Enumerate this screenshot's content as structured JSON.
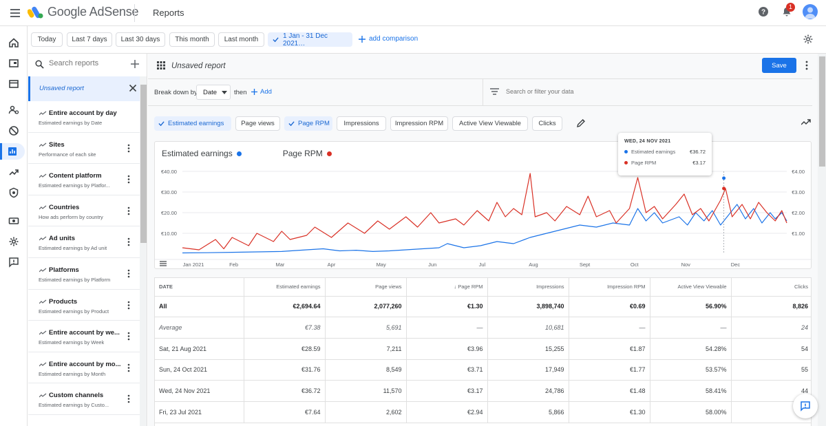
{
  "app": {
    "logo_text": "Google AdSense",
    "page_title": "Reports",
    "notification_count": "1"
  },
  "date_range": {
    "chips": [
      "Today",
      "Last 7 days",
      "Last 30 days",
      "This month",
      "Last month"
    ],
    "selected": "1 Jan - 31 Dec 2021…",
    "add_comparison": "add comparison"
  },
  "reports_panel": {
    "search_placeholder": "Search reports",
    "unsaved_label": "Unsaved report",
    "items": [
      {
        "title": "Entire account by day",
        "subtitle": "Estimated earnings by Date"
      },
      {
        "title": "Sites",
        "subtitle": "Performance of each site"
      },
      {
        "title": "Content platform",
        "subtitle": "Estimated earnings by Platfor..."
      },
      {
        "title": "Countries",
        "subtitle": "How ads perform by country"
      },
      {
        "title": "Ad units",
        "subtitle": "Estimated earnings by Ad unit"
      },
      {
        "title": "Platforms",
        "subtitle": "Estimated earnings by Platform"
      },
      {
        "title": "Products",
        "subtitle": "Estimated earnings by Product"
      },
      {
        "title": "Entire account by we...",
        "subtitle": "Estimated earnings by Week"
      },
      {
        "title": "Entire account by mo...",
        "subtitle": "Estimated earnings by Month"
      },
      {
        "title": "Custom channels",
        "subtitle": "Estimated earnings by Custo..."
      }
    ]
  },
  "main": {
    "report_name": "Unsaved report",
    "save_label": "Save",
    "breakdown_label": "Break down by",
    "breakdown_value": "Date",
    "then_label": "then",
    "add_label": "Add",
    "filter_placeholder": "Search or filter your data",
    "metrics": [
      {
        "label": "Estimated earnings",
        "selected": true
      },
      {
        "label": "Page views",
        "selected": false
      },
      {
        "label": "Page RPM",
        "selected": true
      },
      {
        "label": "Impressions",
        "selected": false
      },
      {
        "label": "Impression RPM",
        "selected": false
      },
      {
        "label": "Active View Viewable",
        "selected": false
      },
      {
        "label": "Clicks",
        "selected": false
      }
    ]
  },
  "chart_data": {
    "type": "line",
    "legend": [
      {
        "name": "Estimated earnings",
        "color": "#1a73e8"
      },
      {
        "name": "Page RPM",
        "color": "#d93025"
      }
    ],
    "x_ticks": [
      "Jan 2021",
      "Feb",
      "Mar",
      "Apr",
      "May",
      "Jun",
      "Jul",
      "Aug",
      "Sept",
      "Oct",
      "Nov",
      "Dec"
    ],
    "y_left_ticks": [
      "€10.00",
      "€20.00",
      "€30.00",
      "€40.00"
    ],
    "y_right_ticks": [
      "€1.00",
      "€2.00",
      "€3.00",
      "€4.00"
    ],
    "y_left_range": [
      0,
      40
    ],
    "y_right_range": [
      0,
      4
    ],
    "x_range_days": [
      0,
      365
    ],
    "series": [
      {
        "name": "Estimated earnings",
        "axis": "left",
        "color": "#1a73e8",
        "points": [
          [
            0,
            0.5
          ],
          [
            15,
            0.6
          ],
          [
            30,
            0.8
          ],
          [
            45,
            1
          ],
          [
            60,
            1.2
          ],
          [
            75,
            2
          ],
          [
            85,
            2.5
          ],
          [
            95,
            1.5
          ],
          [
            105,
            1.8
          ],
          [
            115,
            1.2
          ],
          [
            125,
            1.5
          ],
          [
            135,
            2
          ],
          [
            145,
            2.5
          ],
          [
            155,
            3
          ],
          [
            160,
            5
          ],
          [
            170,
            3
          ],
          [
            180,
            4
          ],
          [
            190,
            6
          ],
          [
            200,
            5
          ],
          [
            210,
            8
          ],
          [
            220,
            10
          ],
          [
            230,
            12
          ],
          [
            240,
            14
          ],
          [
            250,
            13
          ],
          [
            260,
            15
          ],
          [
            270,
            14
          ],
          [
            275,
            22
          ],
          [
            280,
            16
          ],
          [
            285,
            20
          ],
          [
            290,
            15
          ],
          [
            300,
            18
          ],
          [
            305,
            14
          ],
          [
            310,
            20
          ],
          [
            315,
            16
          ],
          [
            320,
            21
          ],
          [
            325,
            14
          ],
          [
            330,
            19
          ],
          [
            335,
            24
          ],
          [
            340,
            17
          ],
          [
            345,
            22
          ],
          [
            350,
            15
          ],
          [
            355,
            20
          ],
          [
            358,
            17
          ],
          [
            362,
            20
          ],
          [
            365,
            16
          ]
        ]
      },
      {
        "name": "Page RPM",
        "axis": "right",
        "color": "#d93025",
        "points": [
          [
            0,
            0.3
          ],
          [
            10,
            0.2
          ],
          [
            20,
            0.7
          ],
          [
            25,
            0.25
          ],
          [
            30,
            0.8
          ],
          [
            40,
            0.4
          ],
          [
            45,
            1.0
          ],
          [
            55,
            0.6
          ],
          [
            60,
            1.1
          ],
          [
            65,
            0.7
          ],
          [
            75,
            0.9
          ],
          [
            80,
            1.3
          ],
          [
            90,
            0.8
          ],
          [
            100,
            1.5
          ],
          [
            110,
            1.0
          ],
          [
            118,
            1.6
          ],
          [
            125,
            1.2
          ],
          [
            135,
            1.8
          ],
          [
            142,
            1.3
          ],
          [
            150,
            2.0
          ],
          [
            155,
            1.5
          ],
          [
            165,
            1.7
          ],
          [
            170,
            1.4
          ],
          [
            178,
            2.1
          ],
          [
            185,
            1.6
          ],
          [
            190,
            2.5
          ],
          [
            195,
            1.8
          ],
          [
            200,
            2.2
          ],
          [
            205,
            1.9
          ],
          [
            210,
            3.9
          ],
          [
            213,
            1.8
          ],
          [
            220,
            2.0
          ],
          [
            225,
            1.6
          ],
          [
            232,
            2.3
          ],
          [
            240,
            1.9
          ],
          [
            245,
            2.8
          ],
          [
            250,
            1.8
          ],
          [
            258,
            2.1
          ],
          [
            262,
            1.5
          ],
          [
            270,
            2.2
          ],
          [
            275,
            3.7
          ],
          [
            280,
            2.0
          ],
          [
            285,
            2.3
          ],
          [
            290,
            1.7
          ],
          [
            298,
            2.4
          ],
          [
            303,
            2.9
          ],
          [
            308,
            1.9
          ],
          [
            313,
            2.2
          ],
          [
            318,
            1.6
          ],
          [
            325,
            2.6
          ],
          [
            328,
            3.17
          ],
          [
            332,
            1.8
          ],
          [
            338,
            2.4
          ],
          [
            343,
            1.7
          ],
          [
            348,
            2.5
          ],
          [
            353,
            2.0
          ],
          [
            358,
            1.6
          ],
          [
            362,
            2.1
          ],
          [
            365,
            1.5
          ]
        ]
      }
    ],
    "tooltip": {
      "date": "WED, 24 NOV 2021",
      "rows": [
        {
          "label": "Estimated earnings",
          "value": "€36.72",
          "color": "#1a73e8"
        },
        {
          "label": "Page RPM",
          "value": "€3.17",
          "color": "#d93025"
        }
      ]
    }
  },
  "table": {
    "headers": [
      "DATE",
      "Estimated earnings",
      "Page views",
      "↓ Page RPM",
      "Impressions",
      "Impression RPM",
      "Active View Viewable",
      "Clicks"
    ],
    "total": [
      "All",
      "€2,694.64",
      "2,077,260",
      "€1.30",
      "3,898,740",
      "€0.69",
      "56.90%",
      "8,826"
    ],
    "average": [
      "Average",
      "€7.38",
      "5,691",
      "—",
      "10,681",
      "—",
      "—",
      "24"
    ],
    "rows": [
      [
        "Sat, 21 Aug 2021",
        "€28.59",
        "7,211",
        "€3.96",
        "15,255",
        "€1.87",
        "54.28%",
        "54"
      ],
      [
        "Sun, 24 Oct 2021",
        "€31.76",
        "8,549",
        "€3.71",
        "17,949",
        "€1.77",
        "53.57%",
        "55"
      ],
      [
        "Wed, 24 Nov 2021",
        "€36.72",
        "11,570",
        "€3.17",
        "24,786",
        "€1.48",
        "58.41%",
        "44"
      ],
      [
        "Fri, 23 Jul 2021",
        "€7.64",
        "2,602",
        "€2.94",
        "5,866",
        "€1.30",
        "58.00%",
        "23"
      ]
    ]
  }
}
